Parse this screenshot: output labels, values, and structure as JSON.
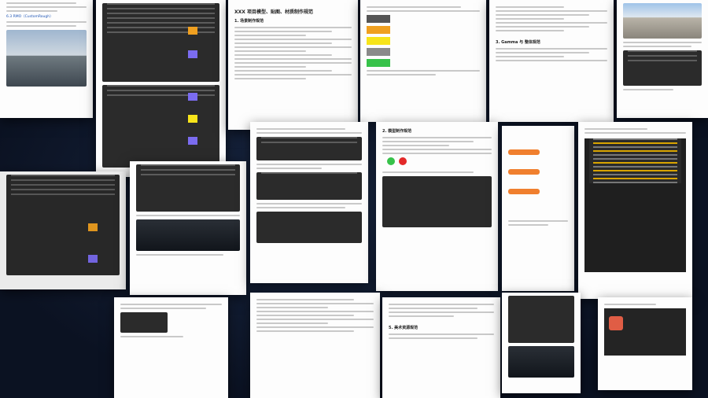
{
  "doc": {
    "title": "XXX 项目模型、贴图、材质制作规范",
    "section_title": "1. 场景制作规范",
    "section_2": "2. 模型制作规范",
    "link_text": "6.3 RMO（CustomRough）",
    "section_3": "3. Gamma 与 整体规范",
    "section_5": "5. 美术资源规范"
  },
  "colors": {
    "background": "#0d1526",
    "swatch_blue": "#7b6cf0",
    "swatch_yellow": "#f7e41a",
    "swatch_orange": "#f0a020",
    "swatch_green": "#37c24a",
    "pill_orange": "#f07f2e"
  }
}
